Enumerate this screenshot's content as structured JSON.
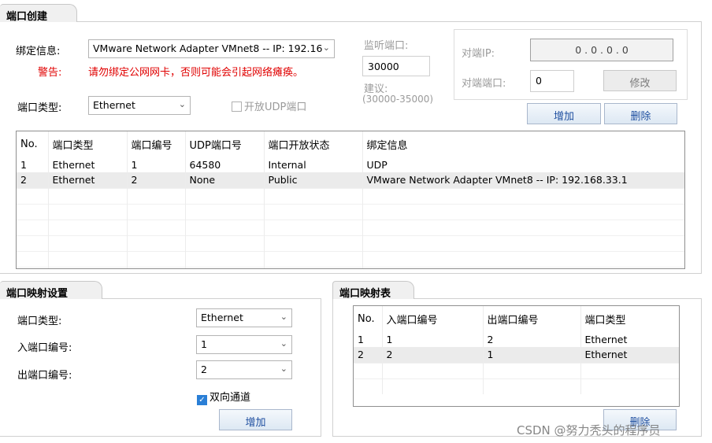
{
  "port_create": {
    "title": "端口创建",
    "bind_label": "绑定信息:",
    "bind_value": "VMware Network Adapter VMnet8 -- IP: 192.16",
    "warning_label": "警告:",
    "warning_text": "请勿绑定公网网卡，否则可能会引起网络瘫痪。",
    "type_label": "端口类型:",
    "type_value": "Ethernet",
    "udp_checkbox_label": "开放UDP端口",
    "listen_label": "监听端口:",
    "listen_value": "30000",
    "suggest_label": "建议:",
    "suggest_range": "(30000-35000)",
    "peer_ip_label": "对端IP:",
    "peer_ip_value": "0  .  0  .  0  .  0",
    "peer_port_label": "对端端口:",
    "peer_port_value": "0",
    "modify_button": "修改",
    "add_button": "增加",
    "delete_button": "删除",
    "table": {
      "headers": [
        "No.",
        "端口类型",
        "端口编号",
        "UDP端口号",
        "端口开放状态",
        "绑定信息"
      ],
      "rows": [
        [
          "1",
          "Ethernet",
          "1",
          "64580",
          "Internal",
          "UDP"
        ],
        [
          "2",
          "Ethernet",
          "2",
          "None",
          "Public",
          "VMware Network Adapter VMnet8 -- IP: 192.168.33.1"
        ]
      ]
    }
  },
  "mapping_settings": {
    "title": "端口映射设置",
    "type_label": "端口类型:",
    "type_value": "Ethernet",
    "in_label": "入端口编号:",
    "in_value": "1",
    "out_label": "出端口编号:",
    "out_value": "2",
    "bidirectional_label": "双向通道",
    "add_button": "增加"
  },
  "mapping_table": {
    "title": "端口映射表",
    "headers": [
      "No.",
      "入端口编号",
      "出端口编号",
      "端口类型"
    ],
    "rows": [
      [
        "1",
        "1",
        "2",
        "Ethernet"
      ],
      [
        "2",
        "2",
        "1",
        "Ethernet"
      ]
    ],
    "delete_button": "删除"
  },
  "watermark": "CSDN @努力秃头的程序员"
}
